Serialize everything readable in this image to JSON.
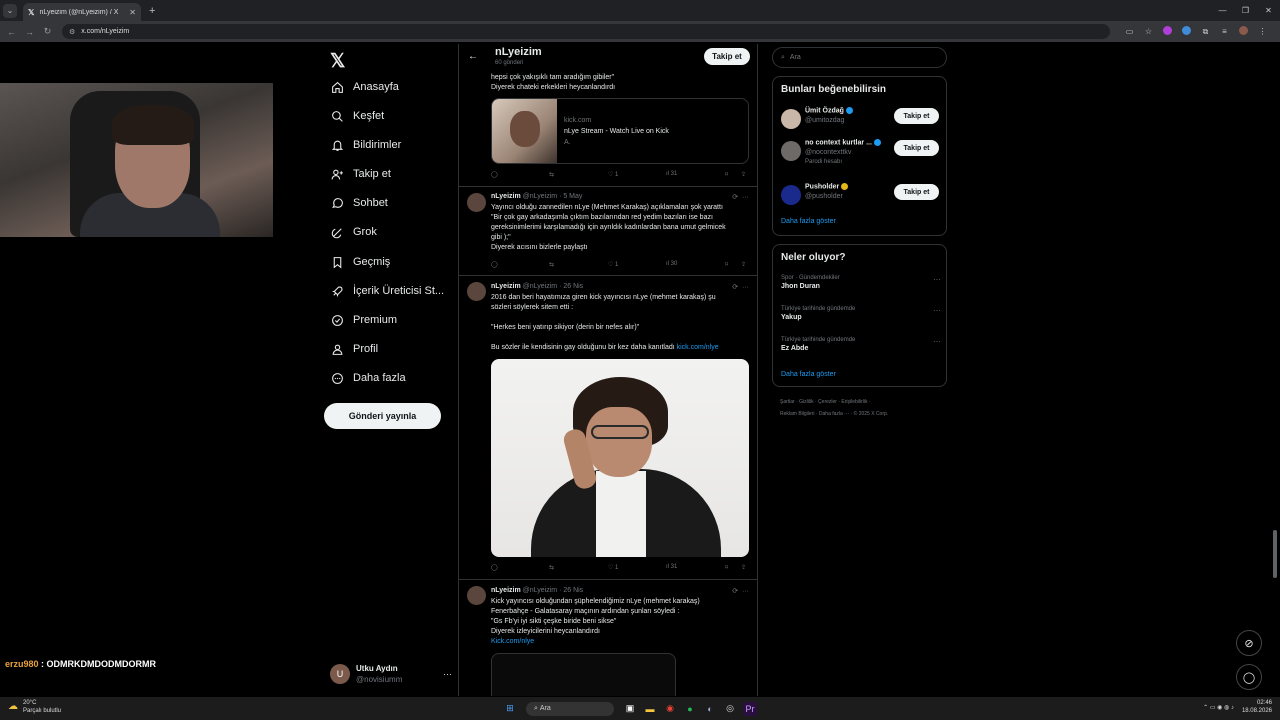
{
  "browser": {
    "tab_title": "nLyeizim (@nLyeizim) / X",
    "url": "x.com/nLyeizim",
    "tab_close": "✕",
    "new_tab": "+"
  },
  "stream_chat": {
    "user": "erzu980",
    "message": ": ODMRKDMDODMDORMR"
  },
  "nav": {
    "items": [
      {
        "label": "Anasayfa",
        "icon": "home-icon"
      },
      {
        "label": "Keşfet",
        "icon": "search-icon"
      },
      {
        "label": "Bildirimler",
        "icon": "bell-icon"
      },
      {
        "label": "Takip et",
        "icon": "add-user-icon"
      },
      {
        "label": "Sohbet",
        "icon": "chat-icon"
      },
      {
        "label": "Grok",
        "icon": "grok-icon"
      },
      {
        "label": "Geçmiş",
        "icon": "bookmark-icon"
      },
      {
        "label": "İçerik Üreticisi St...",
        "icon": "rocket-icon"
      },
      {
        "label": "Premium",
        "icon": "premium-icon"
      },
      {
        "label": "Profil",
        "icon": "profile-icon"
      },
      {
        "label": "Daha fazla",
        "icon": "more-icon"
      }
    ],
    "post_button": "Gönderi yayınla"
  },
  "account": {
    "avatar_letter": "U",
    "name": "Utku Aydın",
    "handle": "@novisiumm"
  },
  "profile_header": {
    "name": "nLyeizim",
    "post_count": "60 gönderi",
    "follow_label": "Takip et"
  },
  "posts": [
    {
      "text_lines": [
        "hepsi çok yakışıklı tam aradığım gibiler\"",
        "Diyerek chateki erkekleri heycanlandırdı"
      ],
      "card": {
        "domain": "kick.com",
        "title": "nLye Stream - Watch Live on Kick",
        "desc": "A."
      },
      "stats": {
        "replies": "",
        "retweets": "",
        "likes": "1",
        "views": "31"
      }
    },
    {
      "author": "nLyeizim",
      "handle": "@nLyeizim · 5 May",
      "text_lines": [
        "Yayıncı olduğu zannedilen nLye (Mehmet Karakaş) açıklamaları şok yarattı",
        "\"Bir çok gay arkadaşımla çıktım bazılarından red yedim bazıları ise bazı",
        "gereksinimlerimi karşılamadığı için ayrıldık kadınlardan bana umut gelmicek",
        "gibi );\"",
        " Diyerek acısını bizlerle paylaştı"
      ],
      "stats": {
        "likes": "1",
        "views": "30"
      }
    },
    {
      "author": "nLyeizim",
      "handle": "@nLyeizim · 26 Nis",
      "text_lines": [
        "2016 dan beri hayatımıza giren kick yayıncısı nLye (mehmet karakaş) şu",
        "sözleri söylerek sitem etti :",
        "",
        "\"Herkes beni yatırıp sikiyor (derin bir nefes alır)\"",
        ""
      ],
      "last_line": "Bu sözler ile kendisinin gay olduğunu bir kez daha kanıtladı",
      "link": "kick.com/nlye",
      "stats": {
        "likes": "1",
        "views": "31"
      }
    },
    {
      "author": "nLyeizim",
      "handle": "@nLyeizim · 26 Nis",
      "text_lines": [
        "Kick yayıncısı olduğundan şüphelendiğimiz nLye (mehmet karakaş)",
        "Fenerbahçe - Galatasaray maçının ardından şunları söyledi :",
        "\"Gs Fb'yi iyi sikti çeşke biride beni sikse\"",
        "Diyerek izleyicilerini heycanlandırdı"
      ],
      "link": "Kick.com/nlye"
    }
  ],
  "right": {
    "search_placeholder": "Ara",
    "who_title": "Bunları beğenebilirsin",
    "who": [
      {
        "name": "Ümit Özdağ",
        "handle": "@umitozdag",
        "extra": "",
        "badge": "blue",
        "button": "Takip et"
      },
      {
        "name": "no context kurtlar ...",
        "handle": "@nocontexttkv",
        "extra": "Parodi hesabı",
        "badge": "blue",
        "button": "Takip et"
      },
      {
        "name": "Pusholder",
        "handle": "@pusholder",
        "extra": "",
        "badge": "gold",
        "button": "Takip et"
      }
    ],
    "who_more": "Daha fazla göster",
    "trends_title": "Neler oluyor?",
    "trends": [
      {
        "category": "Spor · Gündemdekiler",
        "name": "Jhon Duran"
      },
      {
        "category": "Türkiye tarihinde gündemde",
        "name": "Yakup"
      },
      {
        "category": "Türkiye tarihinde gündemde",
        "name": "Ez Abde"
      }
    ],
    "trends_more": "Daha fazla göster",
    "footer_line1": "Şartlar  ·  Gizlilik  ·  Çerezler  ·  Erişilebilirlik  ·",
    "footer_line2": "Reklam Bilgileri  ·  Daha fazla ···  ·  © 2025 X Corp."
  },
  "taskbar": {
    "temp": "20°C",
    "weather": "Parçalı bulutlu",
    "search": "Ara",
    "time": "02:46",
    "date": "18.08.2026"
  },
  "colors": {
    "accent": "#1d9bf0",
    "background": "#000000",
    "border": "#2f3336"
  }
}
